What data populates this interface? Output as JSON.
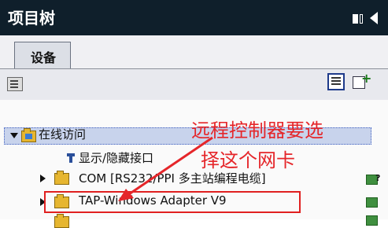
{
  "header": {
    "title": "项目树"
  },
  "tabs": [
    {
      "label": "设备"
    }
  ],
  "tree": {
    "online_access": {
      "label": "在线访问"
    },
    "show_hide": {
      "label": "显示/隐藏接口"
    },
    "com_item": {
      "label": "COM [RS232/PPI 多主站编程电缆]"
    },
    "tap_item": {
      "label": "TAP-Windows Adapter V9"
    }
  },
  "annotation": {
    "line1": "远程控制器要选",
    "line2": "择这个网卡"
  },
  "colors": {
    "annotation": "#e5262a",
    "header_bg": "#0f1f2b",
    "selected_row": "#c8d3ec"
  },
  "icons": [
    "display-toggle-icon",
    "panel-collapse-icon",
    "device-overview-icon",
    "view-icon",
    "add-device-icon",
    "folder-icon",
    "pin-icon",
    "network-status-icon"
  ]
}
